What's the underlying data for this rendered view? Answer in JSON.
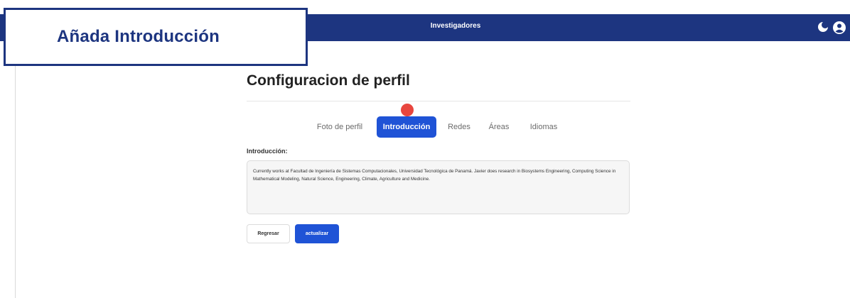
{
  "navbar": {
    "title": "Investigadores",
    "icons": [
      "moon-icon",
      "user-icon"
    ]
  },
  "callout": {
    "text": "Añada Introducción"
  },
  "page": {
    "title": "Configuracion de perfil"
  },
  "tabs": [
    {
      "label": "Foto de perfil",
      "active": false
    },
    {
      "label": "Introducción",
      "active": true
    },
    {
      "label": "Redes",
      "active": false
    },
    {
      "label": "Áreas",
      "active": false
    },
    {
      "label": "Idiomas",
      "active": false
    }
  ],
  "form": {
    "label": "Introducción:",
    "value": "Currently works at Facultad de Ingeniería de Sistemas Computacionales, Universidad Tecnológica de Panamá. Javier does research in Biosystems Engineering, Computing Science in Mathematical Modeling, Natural Science, Engineering, Climate, Agriculture and Medicine."
  },
  "buttons": {
    "back": "Regresar",
    "update": "actualizar"
  },
  "colors": {
    "brand": "#1d3580",
    "accent": "#1f53d6",
    "marker": "#e8463e"
  }
}
